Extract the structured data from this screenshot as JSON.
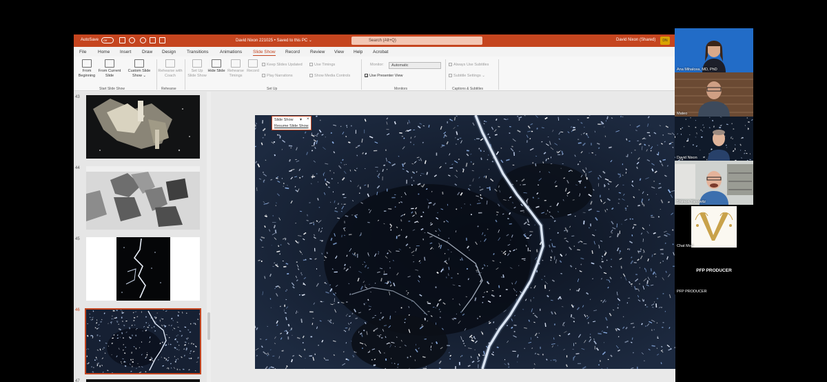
{
  "titlebar": {
    "autosave_label": "AutoSave",
    "autosave_state": "Off",
    "document_title": "David Nixon 221025 • Saved to this PC ⌄",
    "search_placeholder": "Search (Alt+Q)",
    "user_label": "David Nixon (Shared)",
    "user_initials": "DN"
  },
  "menu": {
    "tabs": [
      "File",
      "Home",
      "Insert",
      "Draw",
      "Design",
      "Transitions",
      "Animations",
      "Slide Show",
      "Record",
      "Review",
      "View",
      "Help",
      "Acrobat"
    ],
    "active": "Slide Show"
  },
  "ribbon": {
    "start": {
      "from_beginning": "From Beginning",
      "from_current": "From Current Slide",
      "custom": "Custom Slide Show ⌄",
      "group_label": "Start Slide Show"
    },
    "rehearse": {
      "rehearse_coach": "Rehearse with Coach",
      "group_label": "Rehearse"
    },
    "setup": {
      "setup_show": "Set Up Slide Show",
      "hide_slide": "Hide Slide",
      "rehearse_timings": "Rehearse Timings",
      "record": "Record",
      "keep_updated": "Keep Slides Updated",
      "play_narrations": "Play Narrations",
      "use_timings": "Use Timings",
      "show_media_controls": "Show Media Controls",
      "group_label": "Set Up"
    },
    "monitors": {
      "monitor_label": "Monitor:",
      "monitor_value": "Automatic",
      "presenter_view": "Use Presenter View",
      "group_label": "Monitors"
    },
    "captions": {
      "always_subtitles": "Always Use Subtitles",
      "subtitle_settings": "Subtitle Settings ⌄",
      "group_label": "Captions & Subtitles"
    }
  },
  "popup": {
    "title": "Slide Show",
    "dropdown": "▾",
    "close": "×",
    "resume": "Resume Slide Show"
  },
  "thumbnails": [
    {
      "number": "43",
      "selected": false
    },
    {
      "number": "44",
      "selected": false
    },
    {
      "number": "45",
      "selected": false
    },
    {
      "number": "46",
      "selected": true
    },
    {
      "number": "47",
      "selected": false
    }
  ],
  "participants": [
    {
      "name": "Ana Mihalcea, MD, PhD"
    },
    {
      "name": "Mateo"
    },
    {
      "name": "David Nixon"
    },
    {
      "name": "Shimon Yanowitz"
    },
    {
      "name": "Chat Mod"
    },
    {
      "name": "PFP PRODUCER",
      "center_label": "PFP PRODUCER"
    }
  ],
  "colors": {
    "accent": "#c5451f",
    "gold": "#c9a24a"
  }
}
